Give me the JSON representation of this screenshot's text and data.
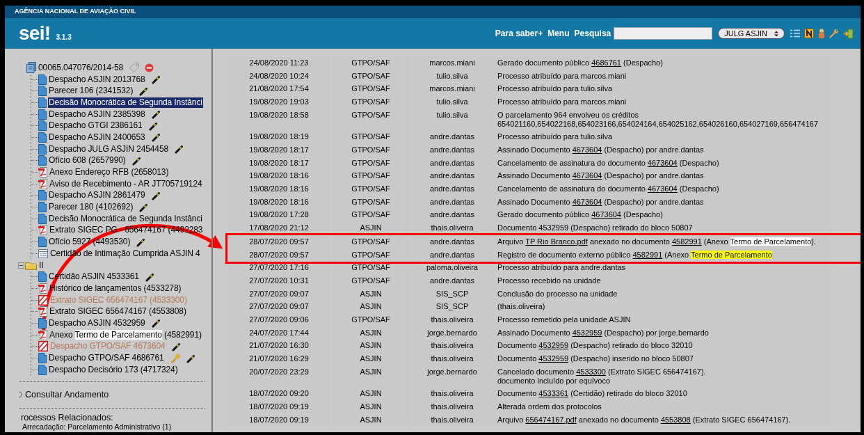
{
  "agency": "AGÊNCIA NACIONAL DE AVIAÇÃO CIVIL",
  "logo": "sei!",
  "version": "3.1.3",
  "nav_links": [
    "Para saber+",
    "Menu",
    "Pesquisa"
  ],
  "unit_select": "JULG ASJIN",
  "tree": [
    {
      "label": "00065.047076/2014-58",
      "kind": "process",
      "selected": false,
      "children": [
        {
          "label": "Despacho ASJIN 2013768",
          "kind": "doc",
          "selected": false,
          "signed": true,
          "restricted": false
        },
        {
          "label": "Parecer 106 (2341532)",
          "kind": "doc",
          "selected": false,
          "signed": true,
          "restricted": false
        },
        {
          "label": "Decisão Monocrática de Segunda Instânci",
          "kind": "doc",
          "selected": true,
          "signed": false,
          "restricted": false
        },
        {
          "label": "Despacho ASJIN 2385398",
          "kind": "doc",
          "selected": false,
          "signed": true,
          "restricted": false
        },
        {
          "label": "Despacho GTGI 2386161",
          "kind": "doc",
          "selected": false,
          "signed": true,
          "restricted": false
        },
        {
          "label": "Despacho ASJIN 2400653",
          "kind": "doc",
          "selected": false,
          "signed": true,
          "restricted": false
        },
        {
          "label": "Despacho JULG ASJIN 2454458",
          "kind": "doc",
          "selected": false,
          "signed": true,
          "restricted": false
        },
        {
          "label": "Ofício 608 (2657990)",
          "kind": "doc",
          "selected": false,
          "signed": true,
          "restricted": false
        },
        {
          "label": "Anexo Endereço RFB (2658013)",
          "kind": "pdf",
          "selected": false,
          "signed": false,
          "restricted": false
        },
        {
          "label": "Aviso de Recebimento - AR JT705719124",
          "kind": "pdf",
          "selected": false,
          "signed": false,
          "restricted": false
        },
        {
          "label": "Despacho ASJIN 2861479",
          "kind": "doc",
          "selected": false,
          "signed": true,
          "restricted": false
        },
        {
          "label": "Parecer 180 (4102692)",
          "kind": "doc",
          "selected": false,
          "signed": true,
          "restricted": false
        },
        {
          "label": "Decisão Monocrática de Segunda Instânci",
          "kind": "doc",
          "selected": false,
          "signed": false,
          "restricted": false
        },
        {
          "label": "Extrato SIGEC PG - 656474167 (4492283",
          "kind": "pdf",
          "selected": false,
          "signed": false,
          "restricted": false
        },
        {
          "label": "Ofício 5927 (4493530)",
          "kind": "doc",
          "selected": false,
          "signed": true,
          "restricted": false
        },
        {
          "label": "Certidão de Intimação Cumprida ASJIN 4",
          "kind": "form",
          "selected": false,
          "signed": false,
          "restricted": false
        }
      ]
    },
    {
      "label": "II",
      "kind": "folder",
      "expanded": true,
      "selected": false,
      "children": [
        {
          "label": "Certidão ASJIN 4533361",
          "kind": "doc",
          "selected": false,
          "signed": true,
          "restricted": false
        },
        {
          "label": "Histórico de lançamentos (4533278)",
          "kind": "pdf",
          "selected": false,
          "signed": false,
          "restricted": false
        },
        {
          "label": "Extrato SIGEC 656474167 (4533300)",
          "kind": "cancelled",
          "selected": false,
          "signed": false,
          "restricted": false
        },
        {
          "label": "Extrato SIGEC 656474167 (4553808)",
          "kind": "pdf",
          "selected": false,
          "signed": false,
          "restricted": false
        },
        {
          "label": "Despacho ASJIN 4532959",
          "kind": "doc",
          "selected": false,
          "signed": true,
          "restricted": false
        },
        {
          "parts": [
            {
              "text": "Anexo ",
              "kind": "text"
            },
            {
              "text": "Termo de Parcelamento",
              "kind": "mark",
              "color": "#ffffff"
            },
            {
              "text": " (4582991)",
              "kind": "text"
            }
          ],
          "kind": "pdf",
          "selected": false,
          "signed": false,
          "restricted": false
        },
        {
          "label": "Despacho GTPO/SAF 4673604",
          "kind": "cancelled",
          "selected": false,
          "signed": true,
          "restricted": false
        },
        {
          "label": "Despacho GTPO/SAF 4686761",
          "kind": "doc",
          "selected": false,
          "signed": true,
          "restricted": true
        },
        {
          "label": "Despacho Decisório 173 (4717324)",
          "kind": "doc",
          "selected": false,
          "signed": false,
          "restricted": false
        }
      ]
    }
  ],
  "consult_link": "Consultar Andamento",
  "related": {
    "title": "rocessos Relacionados:",
    "items": [
      "Arrecadação: Parcelamento Administrativo (1)"
    ]
  },
  "history": [
    {
      "date": "24/08/2020 11:23",
      "unit": "GTPO/SAF",
      "user": "marcos.miani",
      "annotated": false,
      "lines": [
        [
          {
            "text": "Gerado documento público ",
            "kind": "text"
          },
          {
            "text": "4686761",
            "kind": "link"
          },
          {
            "text": " (Despacho)",
            "kind": "text"
          }
        ]
      ]
    },
    {
      "date": "24/08/2020 10:24",
      "unit": "GTPO/SAF",
      "user": "tulio.silva",
      "annotated": false,
      "lines": [
        [
          {
            "text": "Processo atribuído para marcos.miani",
            "kind": "text"
          }
        ]
      ]
    },
    {
      "date": "21/08/2020 17:54",
      "unit": "GTPO/SAF",
      "user": "marcos.miani",
      "annotated": false,
      "lines": [
        [
          {
            "text": "Processo atribuído para tulio.silva",
            "kind": "text"
          }
        ]
      ]
    },
    {
      "date": "19/08/2020 19:03",
      "unit": "GTPO/SAF",
      "user": "tulio.silva",
      "annotated": false,
      "lines": [
        [
          {
            "text": "Processo atribuído para marcos.miani",
            "kind": "text"
          }
        ]
      ]
    },
    {
      "date": "19/08/2020 18:58",
      "unit": "GTPO/SAF",
      "user": "tulio.silva",
      "annotated": false,
      "lines": [
        [
          {
            "text": "O parcelamento 964 envolveu os créditos",
            "kind": "text"
          }
        ],
        [
          {
            "text": "654021160,654022168,654023166,654024164,654025162,654026160,654027169,656474167",
            "kind": "text"
          }
        ]
      ]
    },
    {
      "date": "19/08/2020 18:19",
      "unit": "GTPO/SAF",
      "user": "andre.dantas",
      "annotated": false,
      "lines": [
        [
          {
            "text": "Processo atribuído para tulio.silva",
            "kind": "text"
          }
        ]
      ]
    },
    {
      "date": "19/08/2020 18:17",
      "unit": "GTPO/SAF",
      "user": "andre.dantas",
      "annotated": false,
      "lines": [
        [
          {
            "text": "Assinado Documento ",
            "kind": "text"
          },
          {
            "text": "4673604",
            "kind": "link"
          },
          {
            "text": " (Despacho) por andre.dantas",
            "kind": "text"
          }
        ]
      ]
    },
    {
      "date": "19/08/2020 18:17",
      "unit": "GTPO/SAF",
      "user": "andre.dantas",
      "annotated": false,
      "lines": [
        [
          {
            "text": "Cancelamento de assinatura do documento ",
            "kind": "text"
          },
          {
            "text": "4673604",
            "kind": "link"
          },
          {
            "text": " (Despacho)",
            "kind": "text"
          }
        ]
      ]
    },
    {
      "date": "19/08/2020 18:16",
      "unit": "GTPO/SAF",
      "user": "andre.dantas",
      "annotated": false,
      "lines": [
        [
          {
            "text": "Assinado Documento ",
            "kind": "text"
          },
          {
            "text": "4673604",
            "kind": "link"
          },
          {
            "text": " (Despacho) por andre.dantas",
            "kind": "text"
          }
        ]
      ]
    },
    {
      "date": "19/08/2020 18:16",
      "unit": "GTPO/SAF",
      "user": "andre.dantas",
      "annotated": false,
      "lines": [
        [
          {
            "text": "Cancelamento de assinatura do documento ",
            "kind": "text"
          },
          {
            "text": "4673604",
            "kind": "link"
          },
          {
            "text": " (Despacho)",
            "kind": "text"
          }
        ]
      ]
    },
    {
      "date": "19/08/2020 18:16",
      "unit": "GTPO/SAF",
      "user": "andre.dantas",
      "annotated": false,
      "lines": [
        [
          {
            "text": "Assinado Documento ",
            "kind": "text"
          },
          {
            "text": "4673604",
            "kind": "link"
          },
          {
            "text": " (Despacho) por andre.dantas",
            "kind": "text"
          }
        ]
      ]
    },
    {
      "date": "19/08/2020 17:28",
      "unit": "GTPO/SAF",
      "user": "andre.dantas",
      "annotated": false,
      "lines": [
        [
          {
            "text": "Gerado documento público ",
            "kind": "text"
          },
          {
            "text": "4673604",
            "kind": "link"
          },
          {
            "text": " (Despacho)",
            "kind": "text"
          }
        ]
      ]
    },
    {
      "date": "17/08/2020 21:12",
      "unit": "ASJIN",
      "user": "thais.oliveira",
      "annotated": false,
      "lines": [
        [
          {
            "text": "Documento 4532959 (Despacho) retirado do bloco 50807",
            "kind": "text"
          }
        ]
      ]
    },
    {
      "date": "28/07/2020 09:57",
      "unit": "GTPO/SAF",
      "user": "andre.dantas",
      "annotated": true,
      "lines": [
        [
          {
            "text": "Arquivo ",
            "kind": "text"
          },
          {
            "text": "TP Rio Branco.pdf",
            "kind": "link"
          },
          {
            "text": " anexado no documento ",
            "kind": "text"
          },
          {
            "text": "4582991",
            "kind": "link"
          },
          {
            "text": " (Anexo ",
            "kind": "text"
          },
          {
            "text": "Termo de Parcelamento",
            "kind": "mark",
            "color": "#ffffff"
          },
          {
            "text": ").",
            "kind": "text"
          }
        ]
      ]
    },
    {
      "date": "28/07/2020 09:57",
      "unit": "GTPO/SAF",
      "user": "andre.dantas",
      "annotated": true,
      "lines": [
        [
          {
            "text": "Registro de documento externo público ",
            "kind": "text"
          },
          {
            "text": "4582991",
            "kind": "link"
          },
          {
            "text": " (Anexo ",
            "kind": "text"
          },
          {
            "text": "Termo de Parcelamento",
            "kind": "mark",
            "color": "#ffff00"
          }
        ]
      ]
    },
    {
      "date": "27/07/2020 17:16",
      "unit": "GTPO/SAF",
      "user": "paloma.oliveira",
      "annotated": false,
      "lines": [
        [
          {
            "text": "Processo atribuído para andre.dantas",
            "kind": "text"
          }
        ]
      ]
    },
    {
      "date": "27/07/2020 10:31",
      "unit": "GTPO/SAF",
      "user": "andre.dantas",
      "annotated": false,
      "lines": [
        [
          {
            "text": "Processo recebido na unidade",
            "kind": "text"
          }
        ]
      ]
    },
    {
      "date": "27/07/2020 09:07",
      "unit": "ASJIN",
      "user": "SIS_SCP",
      "annotated": false,
      "lines": [
        [
          {
            "text": "Conclusão do processo na unidade",
            "kind": "text"
          }
        ]
      ]
    },
    {
      "date": "27/07/2020 09:07",
      "unit": "ASJIN",
      "user": "SIS_SCP",
      "annotated": false,
      "lines": [
        [
          {
            "text": "(thais.oliveira)",
            "kind": "text"
          }
        ]
      ]
    },
    {
      "date": "27/07/2020 09:06",
      "unit": "GTPO/SAF",
      "user": "thais.oliveira",
      "annotated": false,
      "lines": [
        [
          {
            "text": "Processo remetido pela unidade ASJIN",
            "kind": "text"
          }
        ]
      ]
    },
    {
      "date": "24/07/2020 17:44",
      "unit": "ASJIN",
      "user": "jorge.bernardo",
      "annotated": false,
      "lines": [
        [
          {
            "text": "Assinado Documento ",
            "kind": "text"
          },
          {
            "text": "4532959",
            "kind": "link"
          },
          {
            "text": " (Despacho) por jorge.bernardo",
            "kind": "text"
          }
        ]
      ]
    },
    {
      "date": "21/07/2020 16:30",
      "unit": "ASJIN",
      "user": "thais.oliveira",
      "annotated": false,
      "lines": [
        [
          {
            "text": "Documento ",
            "kind": "text"
          },
          {
            "text": "4532959",
            "kind": "link"
          },
          {
            "text": " (Despacho) retirado do bloco 32010",
            "kind": "text"
          }
        ]
      ]
    },
    {
      "date": "21/07/2020 16:29",
      "unit": "ASJIN",
      "user": "thais.oliveira",
      "annotated": false,
      "lines": [
        [
          {
            "text": "Documento ",
            "kind": "text"
          },
          {
            "text": "4532959",
            "kind": "link"
          },
          {
            "text": " (Despacho) inserido no bloco 50807",
            "kind": "text"
          }
        ]
      ]
    },
    {
      "date": "20/07/2020 23:29",
      "unit": "ASJIN",
      "user": "jorge.bernardo",
      "annotated": false,
      "lines": [
        [
          {
            "text": "Cancelado documento ",
            "kind": "text"
          },
          {
            "text": "4533300",
            "kind": "link"
          },
          {
            "text": " (Extrato SIGEC 656474167).",
            "kind": "text"
          }
        ],
        [
          {
            "text": "documento incluído por equívoco",
            "kind": "text"
          }
        ]
      ]
    },
    {
      "date": "18/07/2020 09:20",
      "unit": "ASJIN",
      "user": "thais.oliveira",
      "annotated": false,
      "lines": [
        [
          {
            "text": "Documento ",
            "kind": "text"
          },
          {
            "text": "4533361",
            "kind": "link"
          },
          {
            "text": " (Certidão) retirado do bloco 32010",
            "kind": "text"
          }
        ]
      ]
    },
    {
      "date": "18/07/2020 09:19",
      "unit": "ASJIN",
      "user": "thais.oliveira",
      "annotated": false,
      "lines": [
        [
          {
            "text": "Alterada ordem dos protocolos",
            "kind": "text"
          }
        ]
      ]
    },
    {
      "date": "18/07/2020 09:19",
      "unit": "ASJIN",
      "user": "thais.oliveira",
      "annotated": false,
      "lines": [
        [
          {
            "text": "Arquivo ",
            "kind": "text"
          },
          {
            "text": "656474167.pdf",
            "kind": "link"
          },
          {
            "text": " anexado no documento ",
            "kind": "text"
          },
          {
            "text": "4553808",
            "kind": "link"
          },
          {
            "text": " (Extrato SIGEC 656474167).",
            "kind": "text"
          }
        ]
      ]
    }
  ]
}
